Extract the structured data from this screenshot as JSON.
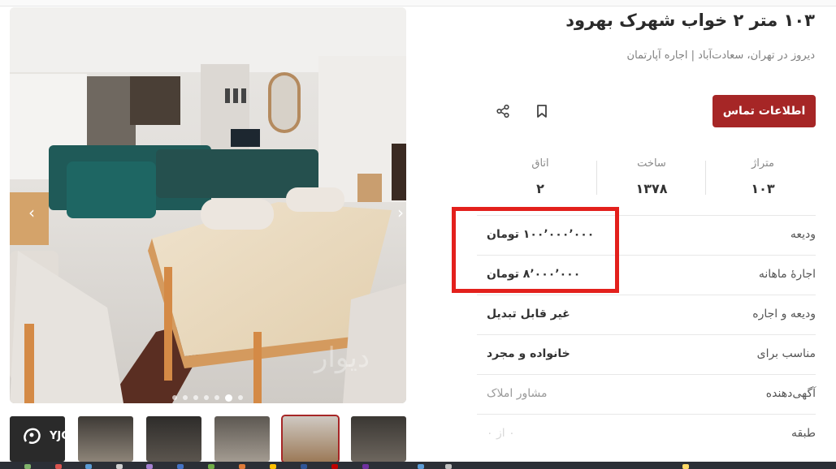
{
  "listing": {
    "title": "۱۰۳ متر ۲ خواب شهرک بهرود",
    "subtitle": "دیروز در تهران، سعادت‌آباد | اجاره آپارتمان",
    "contact_label": "اطلاعات تماس"
  },
  "stats": [
    {
      "label": "متراژ",
      "value": "۱۰۳"
    },
    {
      "label": "ساخت",
      "value": "۱۳۷۸"
    },
    {
      "label": "اتاق",
      "value": "۲"
    }
  ],
  "details": [
    {
      "label": "ودیعه",
      "value": "۱۰۰٬۰۰۰٬۰۰۰ تومان"
    },
    {
      "label": "اجارهٔ ماهانه",
      "value": "۸٬۰۰۰٬۰۰۰ تومان"
    },
    {
      "label": "ودیعه و اجاره",
      "value": "غیر قابل تبدیل"
    },
    {
      "label": "مناسب برای",
      "value": "خانواده و مجرد"
    },
    {
      "label": "آگهی‌دهنده",
      "value": "مشاور املاک"
    },
    {
      "label": "طبقه",
      "value": "۰ از ۰"
    }
  ],
  "gallery": {
    "watermark": "دیوار",
    "dot_count": 7,
    "active_dot": 5
  },
  "overlay": {
    "yjc_label": "YJC"
  },
  "colors": {
    "accent": "#a62626",
    "highlight": "#e3201c"
  }
}
